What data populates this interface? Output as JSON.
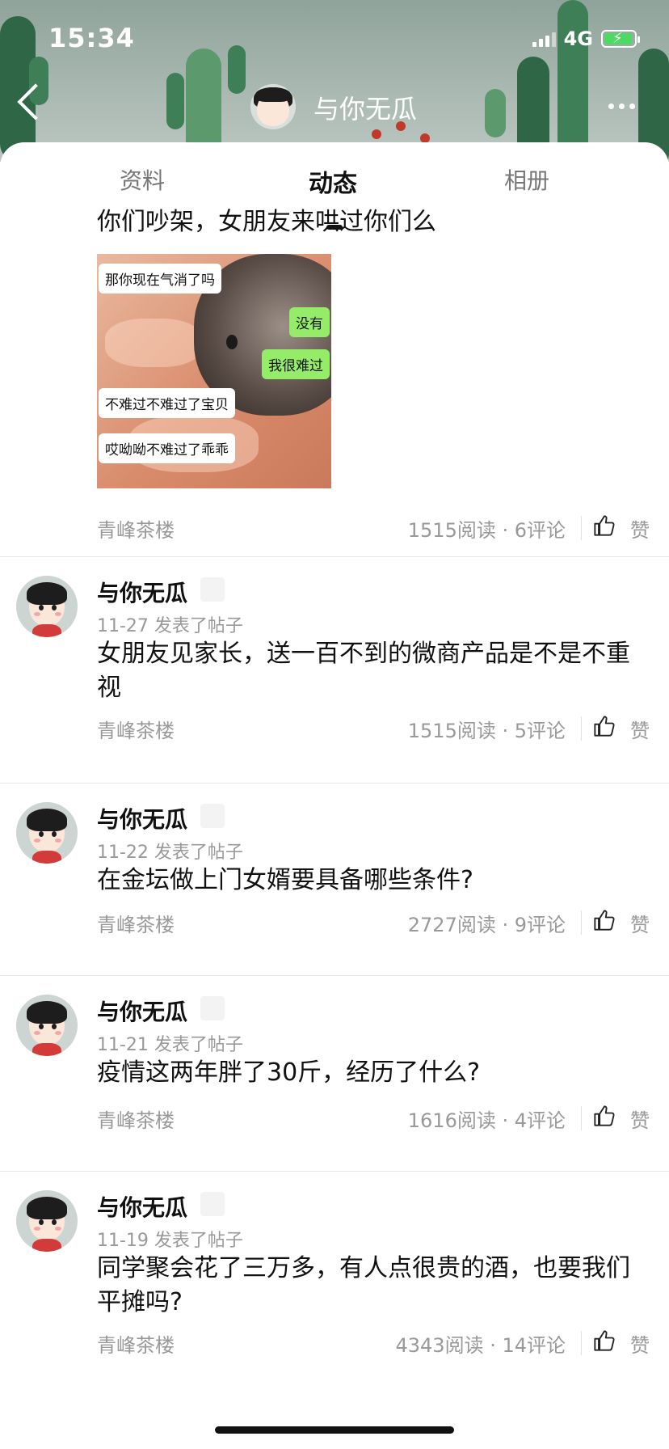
{
  "status_bar": {
    "time": "15:34",
    "network": "4G"
  },
  "header": {
    "title": "与你无瓜",
    "icons": [
      "back-arrow-icon",
      "more-dots-icon"
    ]
  },
  "tabs": [
    {
      "label": "资料",
      "active": false
    },
    {
      "label": "动态",
      "active": true
    },
    {
      "label": "相册",
      "active": false
    }
  ],
  "colors": {
    "accent_green": "#95ec69",
    "avatar_shirt": "#d33a3a"
  },
  "first_post": {
    "text": "你们吵架，女朋友来哄过你们么",
    "image_bubbles": [
      {
        "text": "那你现在气消了吗",
        "side": "left"
      },
      {
        "text": "没有",
        "side": "right"
      },
      {
        "text": "我很难过",
        "side": "right"
      },
      {
        "text": "不难过不难过了宝贝",
        "side": "left"
      },
      {
        "text": "哎呦呦不难过了乖乖",
        "side": "left"
      }
    ],
    "source": "青峰茶楼",
    "stats": "1515阅读 · 6评论",
    "like_label": "赞"
  },
  "posts": [
    {
      "name": "与你无瓜",
      "date": "11-27 发表了帖子",
      "body": "女朋友见家长，送一百不到的微商产品是不是不重视",
      "source": "青峰茶楼",
      "stats": "1515阅读 · 5评论",
      "like_label": "赞"
    },
    {
      "name": "与你无瓜",
      "date": "11-22 发表了帖子",
      "body": "在金坛做上门女婿要具备哪些条件?",
      "source": "青峰茶楼",
      "stats": "2727阅读 · 9评论",
      "like_label": "赞"
    },
    {
      "name": "与你无瓜",
      "date": "11-21 发表了帖子",
      "body": "疫情这两年胖了30斤，经历了什么?",
      "source": "青峰茶楼",
      "stats": "1616阅读 · 4评论",
      "like_label": "赞"
    },
    {
      "name": "与你无瓜",
      "date": "11-19 发表了帖子",
      "body": "同学聚会花了三万多，有人点很贵的酒，也要我们平摊吗?",
      "source": "青峰茶楼",
      "stats": "4343阅读 · 14评论",
      "like_label": "赞"
    }
  ]
}
